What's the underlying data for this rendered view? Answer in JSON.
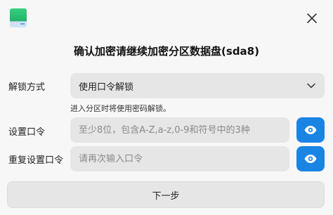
{
  "window": {
    "title": "确认加密请继续加密分区数据盘(sda8)",
    "app_icon": "disk-encryption-icon",
    "close_icon": "close-icon"
  },
  "unlock_method": {
    "label": "解锁方式",
    "selected": "使用口令解锁",
    "hint": "进入分区时将使用密码解锁。"
  },
  "passphrase": {
    "label": "设置口令",
    "placeholder": "至少8位，包含A-Z,a-z,0-9和符号中的3种",
    "value": ""
  },
  "repeat_passphrase": {
    "label": "重复设置口令",
    "placeholder": "请再次输入口令",
    "value": ""
  },
  "actions": {
    "next_label": "下一步"
  },
  "colors": {
    "accent": "#1a84e5",
    "field_bg": "#e6e6e6",
    "window_bg": "#f7f7f7"
  }
}
